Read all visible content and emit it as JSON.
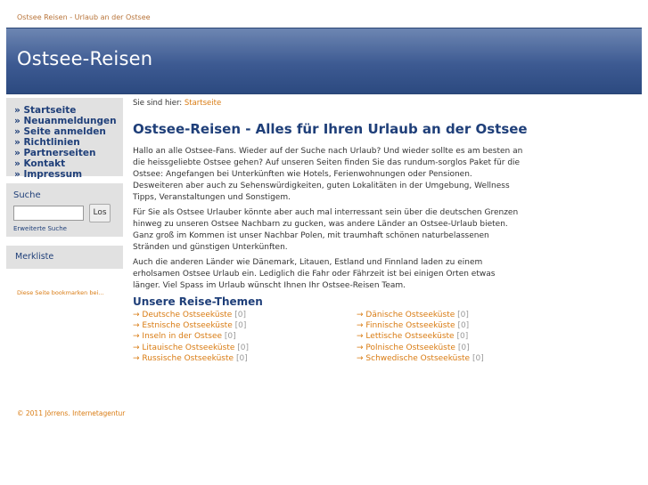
{
  "topbar": {
    "text": "Ostsee Reisen - Urlaub an der Ostsee"
  },
  "header": {
    "title": "Ostsee-Reisen"
  },
  "nav": {
    "items": [
      "» Startseite",
      "» Neuanmeldungen",
      "» Seite anmelden",
      "» Richtlinien",
      "» Partnerseiten",
      "» Kontakt",
      "» Impressum"
    ]
  },
  "search": {
    "label": "Suche",
    "input_value": "",
    "button_label": "Los",
    "advanced_link": "Erweiterte Suche"
  },
  "bookmarks": {
    "label": "Merkliste",
    "link": "Diese Seite bookmarken bei..."
  },
  "breadcrumb": {
    "prefix": "Sie sind hier:",
    "current": "Startseite"
  },
  "main": {
    "headline": "Ostsee-Reisen - Alles für Ihren Urlaub an der Ostsee",
    "paragraphs": [
      "Hallo an alle Ostsee-Fans. Wieder auf der Suche nach Urlaub? Und wieder sollte es am besten an die heissgeliebte Ostsee gehen? Auf unseren Seiten finden Sie das rundum-sorglos Paket für die Ostsee: Angefangen bei Unterkünften wie Hotels, Ferienwohnungen oder Pensionen. Desweiteren aber auch zu Sehenswürdigkeiten, guten Lokalitäten in der Umgebung, Wellness Tipps, Veranstaltungen und Sonstigem.",
      "Für Sie als Ostsee Urlauber könnte aber auch mal interressant sein über die deutschen Grenzen hinweg zu unseren Ostsee Nachbarn zu gucken, was andere Länder an Ostsee-Urlaub bieten. Ganz groß im Kommen ist unser Nachbar Polen, mit traumhaft schönen naturbelassenen Stränden und günstigen Unterkünften.",
      "Auch die anderen Länder wie Dänemark, Litauen, Estland und Finnland laden zu einem erholsamen Ostsee Urlaub ein. Lediglich die Fahr oder Fährzeit ist bei einigen Orten etwas länger. Viel Spass im Urlaub wünscht Ihnen Ihr Ostsee-Reisen Team."
    ],
    "themes_title": "Unsere Reise-Themen",
    "themes_left": [
      {
        "label": "Deutsche Ostseeküste",
        "count": "[0]"
      },
      {
        "label": "Estnische Ostseeküste",
        "count": "[0]"
      },
      {
        "label": "Inseln in der Ostsee",
        "count": "[0]"
      },
      {
        "label": "Litauische Ostseeküste",
        "count": "[0]"
      },
      {
        "label": "Russische Ostseeküste",
        "count": "[0]"
      }
    ],
    "themes_right": [
      {
        "label": "Dänische Ostseeküste",
        "count": "[0]"
      },
      {
        "label": "Finnische Ostseeküste",
        "count": "[0]"
      },
      {
        "label": "Lettische Ostseeküste",
        "count": "[0]"
      },
      {
        "label": "Polnische Ostseeküste",
        "count": "[0]"
      },
      {
        "label": "Schwedische Ostseeküste",
        "count": "[0]"
      }
    ],
    "arrow_icon": "arrow-right-icon"
  },
  "footer": {
    "text": "© 2011 Jörrens. Internetagentur"
  },
  "colors": {
    "brand": "#3d5a92",
    "link": "#d97b12",
    "nav_text": "#1f3f79",
    "box_bg": "#e1e1e1"
  }
}
